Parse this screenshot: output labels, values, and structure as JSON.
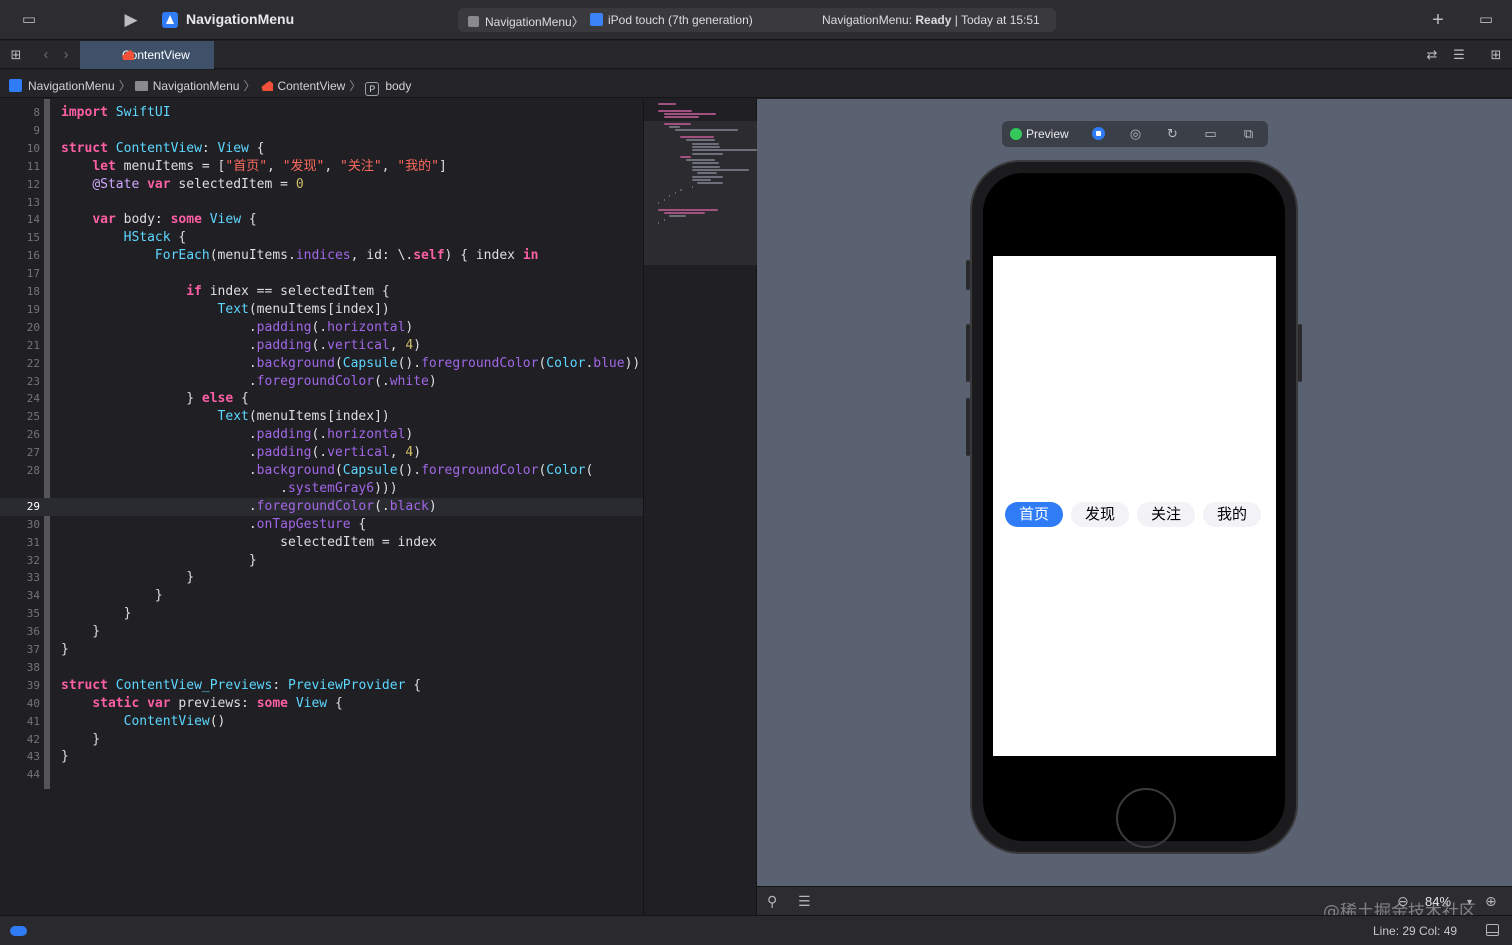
{
  "toolbar": {
    "run_icon": "play-icon",
    "project_name": "NavigationMenu",
    "scheme": "NavigationMenu",
    "scheme_sep": "〉",
    "device": "iPod touch (7th generation)",
    "status_prefix": "NavigationMenu: ",
    "status_state": "Ready",
    "status_sep": " | ",
    "status_time": "Today at 15:51",
    "add_label": "+"
  },
  "tabs": [
    {
      "label": "ContentView",
      "active": true
    }
  ],
  "jumpbar": {
    "items": [
      "NavigationMenu",
      "NavigationMenu",
      "ContentView",
      "body"
    ],
    "sep": "〉",
    "property_badge": "P"
  },
  "editor": {
    "current_line": 29,
    "lines": [
      {
        "n": "8"
      },
      {
        "n": "9"
      },
      {
        "n": "10"
      },
      {
        "n": "11"
      },
      {
        "n": "12"
      },
      {
        "n": "13"
      },
      {
        "n": "14"
      },
      {
        "n": "15"
      },
      {
        "n": "16"
      },
      {
        "n": "17"
      },
      {
        "n": "18"
      },
      {
        "n": "19"
      },
      {
        "n": "20"
      },
      {
        "n": "21"
      },
      {
        "n": "22"
      },
      {
        "n": "23"
      },
      {
        "n": "24"
      },
      {
        "n": "25"
      },
      {
        "n": "26"
      },
      {
        "n": "27"
      },
      {
        "n": "28"
      },
      {
        "n": ""
      },
      {
        "n": "29"
      },
      {
        "n": "30"
      },
      {
        "n": "31"
      },
      {
        "n": "32"
      },
      {
        "n": "33"
      },
      {
        "n": "34"
      },
      {
        "n": "35"
      },
      {
        "n": "36"
      },
      {
        "n": "37"
      },
      {
        "n": "38"
      },
      {
        "n": "39"
      },
      {
        "n": "40"
      },
      {
        "n": "41"
      },
      {
        "n": "42"
      },
      {
        "n": "43"
      },
      {
        "n": "44"
      }
    ],
    "code": [
      "import SwiftUI",
      "",
      "struct ContentView: View {",
      "    let menuItems = [\"首页\", \"发现\", \"关注\", \"我的\"]",
      "    @State var selectedItem = 0",
      "",
      "    var body: some View {",
      "        HStack {",
      "            ForEach(menuItems.indices, id: \\.self) { index in",
      "",
      "                if index == selectedItem {",
      "                    Text(menuItems[index])",
      "                        .padding(.horizontal)",
      "                        .padding(.vertical, 4)",
      "                        .background(Capsule().foregroundColor(Color.blue))",
      "                        .foregroundColor(.white)",
      "                } else {",
      "                    Text(menuItems[index])",
      "                        .padding(.horizontal)",
      "                        .padding(.vertical, 4)",
      "                        .background(Capsule().foregroundColor(Color(",
      "                            .systemGray6)))",
      "                        .foregroundColor(.black)",
      "                        .onTapGesture {",
      "                            selectedItem = index",
      "                        }",
      "                }",
      "            }",
      "        }",
      "    }",
      "}",
      "",
      "struct ContentView_Previews: PreviewProvider {",
      "    static var previews: some View {",
      "        ContentView()",
      "    }",
      "}",
      ""
    ]
  },
  "preview": {
    "label": "Preview",
    "menu_items": [
      "首页",
      "发现",
      "关注",
      "我的"
    ],
    "selected_index": 0,
    "selected_color": "#2f7cf6",
    "unselected_color": "#f2f2f7"
  },
  "canvas_bar": {
    "zoom": "84%",
    "watermark": "@稀土掘金技术社区"
  },
  "statusbar": {
    "position": "Line: 29  Col: 49"
  }
}
